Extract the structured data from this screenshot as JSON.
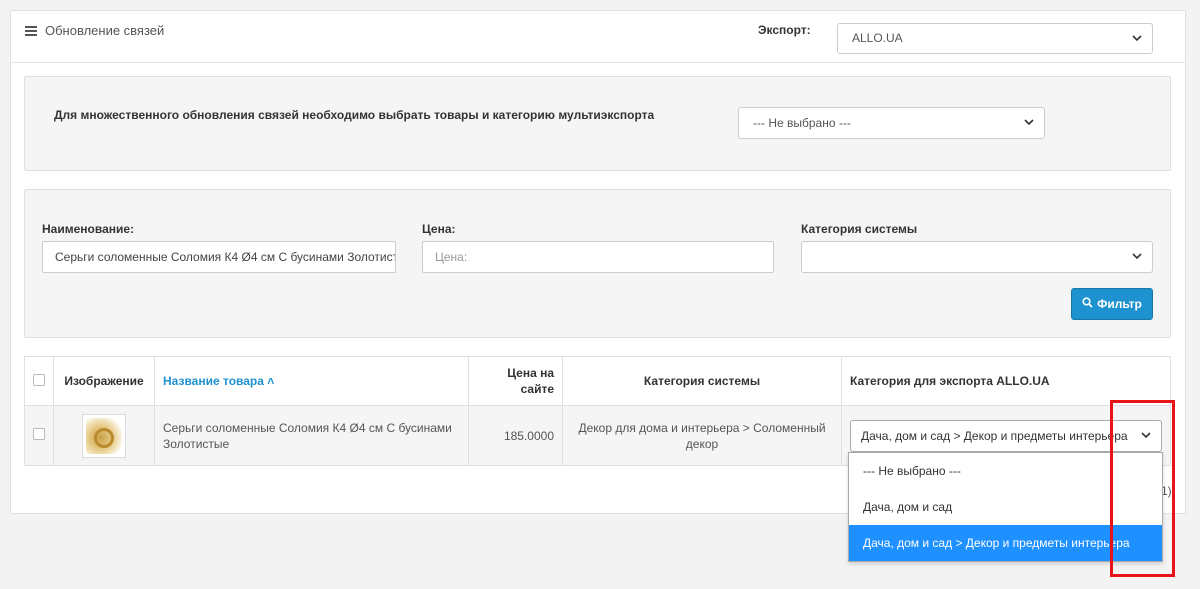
{
  "header": {
    "title": "Обновление связей",
    "export_label": "Экспорт:",
    "export_value": "ALLO.UA"
  },
  "multi": {
    "description": "Для множественного обновления связей необходимо выбрать товары и категорию мультиэкспорта",
    "select_value": "--- Не выбрано ---"
  },
  "filter": {
    "name_label": "Наименование:",
    "name_value": "Серьги соломенные Соломия К4 Ø4 см С бусинами Золотистые",
    "price_label": "Цена:",
    "price_placeholder": "Цена:",
    "category_label": "Категория системы",
    "category_value": "",
    "button_label": "Фильтр",
    "button_icon": "search-icon"
  },
  "table": {
    "headers": {
      "image": "Изображение",
      "name": "Название товара",
      "price_line1": "Цена на",
      "price_line2": "сайте",
      "system_category": "Категория системы",
      "export_category": "Категория для экспорта ALLO.UA"
    },
    "rows": [
      {
        "name": "Серьги соломенные Соломия К4 Ø4 см С бусинами Золотистые",
        "price": "185.0000",
        "system_category": "Декор для дома и интерьера  >  Соломенный декор",
        "export_category": "Дача, дом и сад > Декор и предметы интерьера"
      }
    ]
  },
  "dropdown": {
    "options": [
      "--- Не выбрано ---",
      "Дача, дом и сад",
      "Дача, дом и сад > Декор и предметы интерьера"
    ],
    "selected_index": 2,
    "selected_color": "#1e90ff"
  },
  "pagination": {
    "text": "1)"
  },
  "colors": {
    "accent": "#1e91cf",
    "highlight": "#e8141a"
  }
}
